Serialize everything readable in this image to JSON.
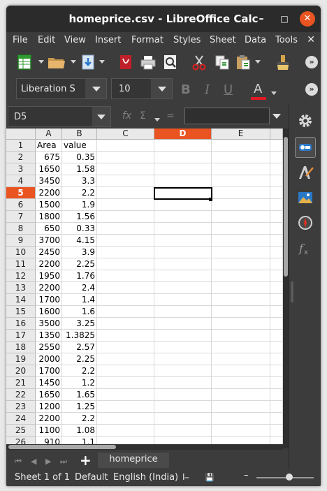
{
  "window": {
    "title": "homeprice.csv - LibreOffice Calc",
    "minimize_glyph": "–",
    "maximize_glyph": "□",
    "close_glyph": "✕"
  },
  "menubar": {
    "items": [
      "File",
      "Edit",
      "View",
      "Insert",
      "Format",
      "Styles",
      "Sheet",
      "Data",
      "Tools"
    ],
    "close_glyph": "✕"
  },
  "toolbar": {
    "overflow_glyph": "»",
    "icons": [
      "new-spreadsheet-icon",
      "open-folder-icon",
      "save-download-icon",
      "export-pdf-icon",
      "print-icon",
      "print-preview-icon",
      "cut-scissors-icon",
      "copy-icon",
      "paste-icon",
      "clone-formatting-brush-icon"
    ]
  },
  "formatting": {
    "font_name": "Liberation S",
    "font_size": "10",
    "bold": "B",
    "italic": "I",
    "underline": "U",
    "font_color": "A",
    "font_color_hex": "#e01b24",
    "overflow_glyph": "»"
  },
  "formula_bar": {
    "name_box": "D5",
    "fx": "fx",
    "sum": "Σ",
    "equals": "=",
    "content": ""
  },
  "grid": {
    "columns": [
      "A",
      "B",
      "C",
      "D",
      "E"
    ],
    "active_column": "D",
    "active_row": "5",
    "rows": [
      {
        "num": "1",
        "a": "Area",
        "b": "value"
      },
      {
        "num": "2",
        "a": "675",
        "b": "0.35"
      },
      {
        "num": "3",
        "a": "1650",
        "b": "1.58"
      },
      {
        "num": "4",
        "a": "3450",
        "b": "3.3"
      },
      {
        "num": "5",
        "a": "2200",
        "b": "2.2"
      },
      {
        "num": "6",
        "a": "1500",
        "b": "1.9"
      },
      {
        "num": "7",
        "a": "1800",
        "b": "1.56"
      },
      {
        "num": "8",
        "a": "650",
        "b": "0.33"
      },
      {
        "num": "9",
        "a": "3700",
        "b": "4.15"
      },
      {
        "num": "10",
        "a": "2450",
        "b": "3.9"
      },
      {
        "num": "11",
        "a": "2200",
        "b": "2.25"
      },
      {
        "num": "12",
        "a": "1950",
        "b": "1.76"
      },
      {
        "num": "13",
        "a": "2200",
        "b": "2.4"
      },
      {
        "num": "14",
        "a": "1700",
        "b": "1.4"
      },
      {
        "num": "15",
        "a": "1600",
        "b": "1.6"
      },
      {
        "num": "16",
        "a": "3500",
        "b": "3.25"
      },
      {
        "num": "17",
        "a": "1350",
        "b": "1.3825"
      },
      {
        "num": "18",
        "a": "2550",
        "b": "2.57"
      },
      {
        "num": "19",
        "a": "2000",
        "b": "2.25"
      },
      {
        "num": "20",
        "a": "1700",
        "b": "2.2"
      },
      {
        "num": "21",
        "a": "1450",
        "b": "1.2"
      },
      {
        "num": "22",
        "a": "1650",
        "b": "1.65"
      },
      {
        "num": "23",
        "a": "1200",
        "b": "1.25"
      },
      {
        "num": "24",
        "a": "2200",
        "b": "2.2"
      },
      {
        "num": "25",
        "a": "1100",
        "b": "1.08"
      },
      {
        "num": "26",
        "a": "910",
        "b": "1.1"
      }
    ]
  },
  "sheet_tabs": {
    "add_glyph": "+",
    "tabs": [
      "homeprice"
    ]
  },
  "statusbar": {
    "sheet": "Sheet 1 of 1",
    "page_style": "Default",
    "language": "English (India)"
  },
  "sidebar": {
    "icons": [
      "properties-gear-icon",
      "page-toggle-icon",
      "styles-brush-icon",
      "gallery-image-icon",
      "navigator-compass-icon",
      "functions-fx-icon"
    ]
  },
  "colors": {
    "accent": "#e95420",
    "chrome": "#3c3c3c",
    "titlebar": "#2b2b2b"
  }
}
